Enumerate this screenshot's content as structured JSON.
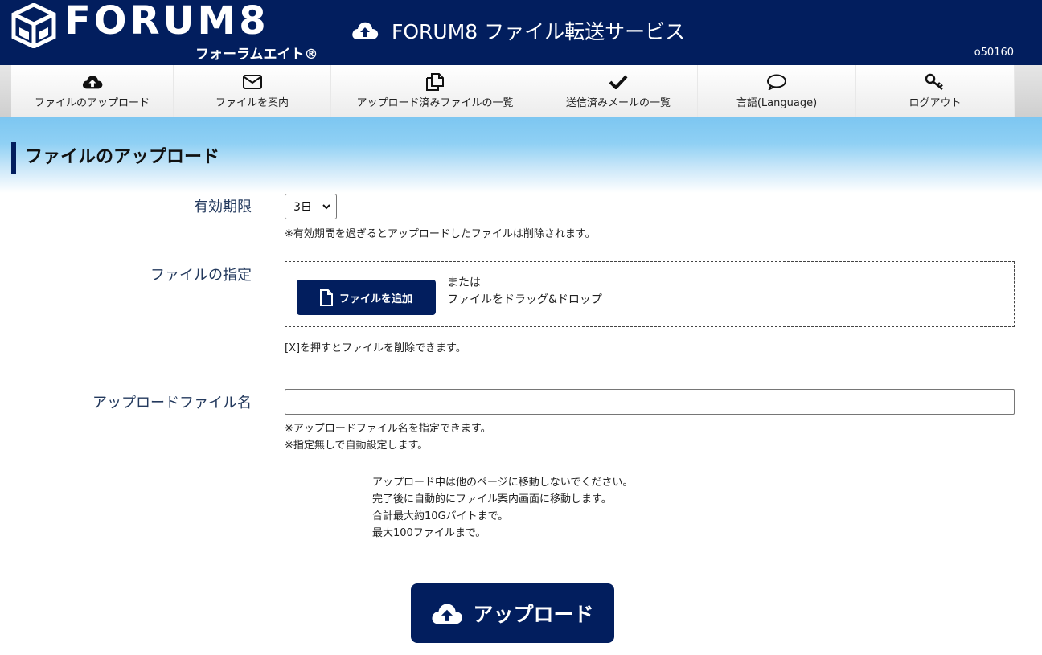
{
  "header": {
    "logo_text": "FORUM8",
    "logo_subtitle": "フォーラムエイト®",
    "service_title": "FORUM8 ファイル転送サービス",
    "user_id": "o50160"
  },
  "nav": {
    "items": [
      {
        "label": "ファイルのアップロード",
        "icon": "cloud-upload-icon"
      },
      {
        "label": "ファイルを案内",
        "icon": "envelope-icon"
      },
      {
        "label": "アップロード済みファイルの一覧",
        "icon": "copy-files-icon"
      },
      {
        "label": "送信済みメールの一覧",
        "icon": "check-icon"
      },
      {
        "label": "言語(Language)",
        "icon": "speech-bubble-icon"
      },
      {
        "label": "ログアウト",
        "icon": "key-icon"
      }
    ]
  },
  "page": {
    "title": "ファイルのアップロード"
  },
  "form": {
    "expiry": {
      "label": "有効期限",
      "selected": "3日",
      "note": "※有効期間を過ぎるとアップロードしたファイルは削除されます。"
    },
    "file": {
      "label": "ファイルの指定",
      "add_button": "ファイルを追加",
      "or_text": "または",
      "drag_text": "ファイルをドラッグ&ドロップ",
      "note": "[X]を押すとファイルを削除できます。"
    },
    "upload_name": {
      "label": "アップロードファイル名",
      "value": "",
      "note1": "※アップロードファイル名を指定できます。",
      "note2": "※指定無しで自動設定します。"
    },
    "info": {
      "line1": "アップロード中は他のページに移動しないでください。",
      "line2": "完了後に自動的にファイル案内画面に移動します。",
      "line3": "合計最大約10Gバイトまで。",
      "line4": "最大100ファイルまで。"
    },
    "upload_button": "アップロード"
  },
  "colors": {
    "navy": "#021e5e",
    "sky": "#7cc6f1",
    "label_text": "#23395d"
  }
}
